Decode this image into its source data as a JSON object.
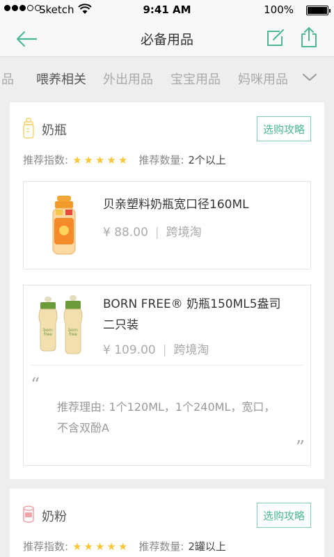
{
  "status_bar": {
    "carrier": "Sketch",
    "time": "9:41 AM",
    "battery": "100%"
  },
  "nav": {
    "title": "必备用品"
  },
  "tabs": [
    {
      "label": "用品"
    },
    {
      "label": "喂养相关",
      "active": true
    },
    {
      "label": "外出用品"
    },
    {
      "label": "宝宝用品"
    },
    {
      "label": "妈咪用品"
    }
  ],
  "categories": [
    {
      "name": "奶瓶",
      "guide_label": "选购攻略",
      "rating_label": "推荐指数:",
      "stars": 5,
      "qty_label": "推荐数量:",
      "qty_value": "2个以上",
      "products": [
        {
          "name": "贝亲塑料奶瓶宽口径160ML",
          "price": "¥ 88.00",
          "source": "跨境淘"
        },
        {
          "name": "BORN FREE® 奶瓶150ML5盎司二只装",
          "price": "¥ 109.00",
          "source": "跨境淘",
          "reason": "推荐理由: 1个120ML，1个240ML，宽口，不含双酚A"
        }
      ]
    },
    {
      "name": "奶粉",
      "guide_label": "选购攻略",
      "rating_label": "推荐指数:",
      "stars": 5,
      "qty_label": "推荐数量:",
      "qty_value": "2罐以上"
    }
  ],
  "icons": {
    "back": "arrow-left-icon",
    "edit": "edit-icon",
    "share": "share-icon",
    "more": "chevron-down-icon",
    "bottle": "bottle-icon",
    "formula": "formula-can-icon",
    "star": "star-icon"
  },
  "colors": {
    "accent": "#4cb891",
    "star": "#f7c739",
    "bottle_icon": "#f5d46a",
    "formula_icon": "#f2a3a8"
  }
}
